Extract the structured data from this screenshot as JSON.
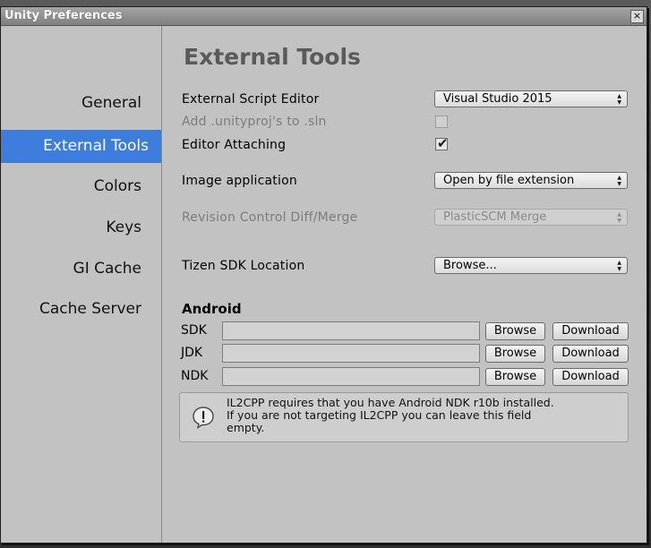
{
  "window": {
    "title": "Unity Preferences",
    "close_glyph": "×"
  },
  "sidebar": {
    "items": [
      {
        "label": "General"
      },
      {
        "label": "External Tools"
      },
      {
        "label": "Colors"
      },
      {
        "label": "Keys"
      },
      {
        "label": "GI Cache"
      },
      {
        "label": "Cache Server"
      }
    ],
    "selected": "External Tools"
  },
  "main": {
    "section_title": "External Tools",
    "external_script_editor": {
      "label": "External Script Editor",
      "value": "Visual Studio 2015"
    },
    "add_unityproj": {
      "label": "Add .unityproj's to .sln",
      "checked": false,
      "enabled": false
    },
    "editor_attaching": {
      "label": "Editor Attaching",
      "checked": true
    },
    "image_application": {
      "label": "Image application",
      "value": "Open by file extension"
    },
    "revision_control": {
      "label": "Revision Control Diff/Merge",
      "value": "PlasticSCM Merge",
      "enabled": false
    },
    "tizen_sdk": {
      "label": "Tizen SDK Location",
      "value": "Browse..."
    },
    "android": {
      "title": "Android",
      "rows": [
        {
          "label": "SDK",
          "path": "",
          "browse": "Browse",
          "download": "Download"
        },
        {
          "label": "JDK",
          "path": "",
          "browse": "Browse",
          "download": "Download"
        },
        {
          "label": "NDK",
          "path": "",
          "browse": "Browse",
          "download": "Download"
        }
      ]
    },
    "help": {
      "icon": "info-icon",
      "text_line1": "IL2CPP requires that you have Android NDK r10b installed.",
      "text_line2": "If you are not targeting IL2CPP you can leave this field",
      "text_line3": "empty."
    }
  },
  "colors": {
    "selection": "#3e7ddb",
    "panel": "#c2c2c2"
  }
}
